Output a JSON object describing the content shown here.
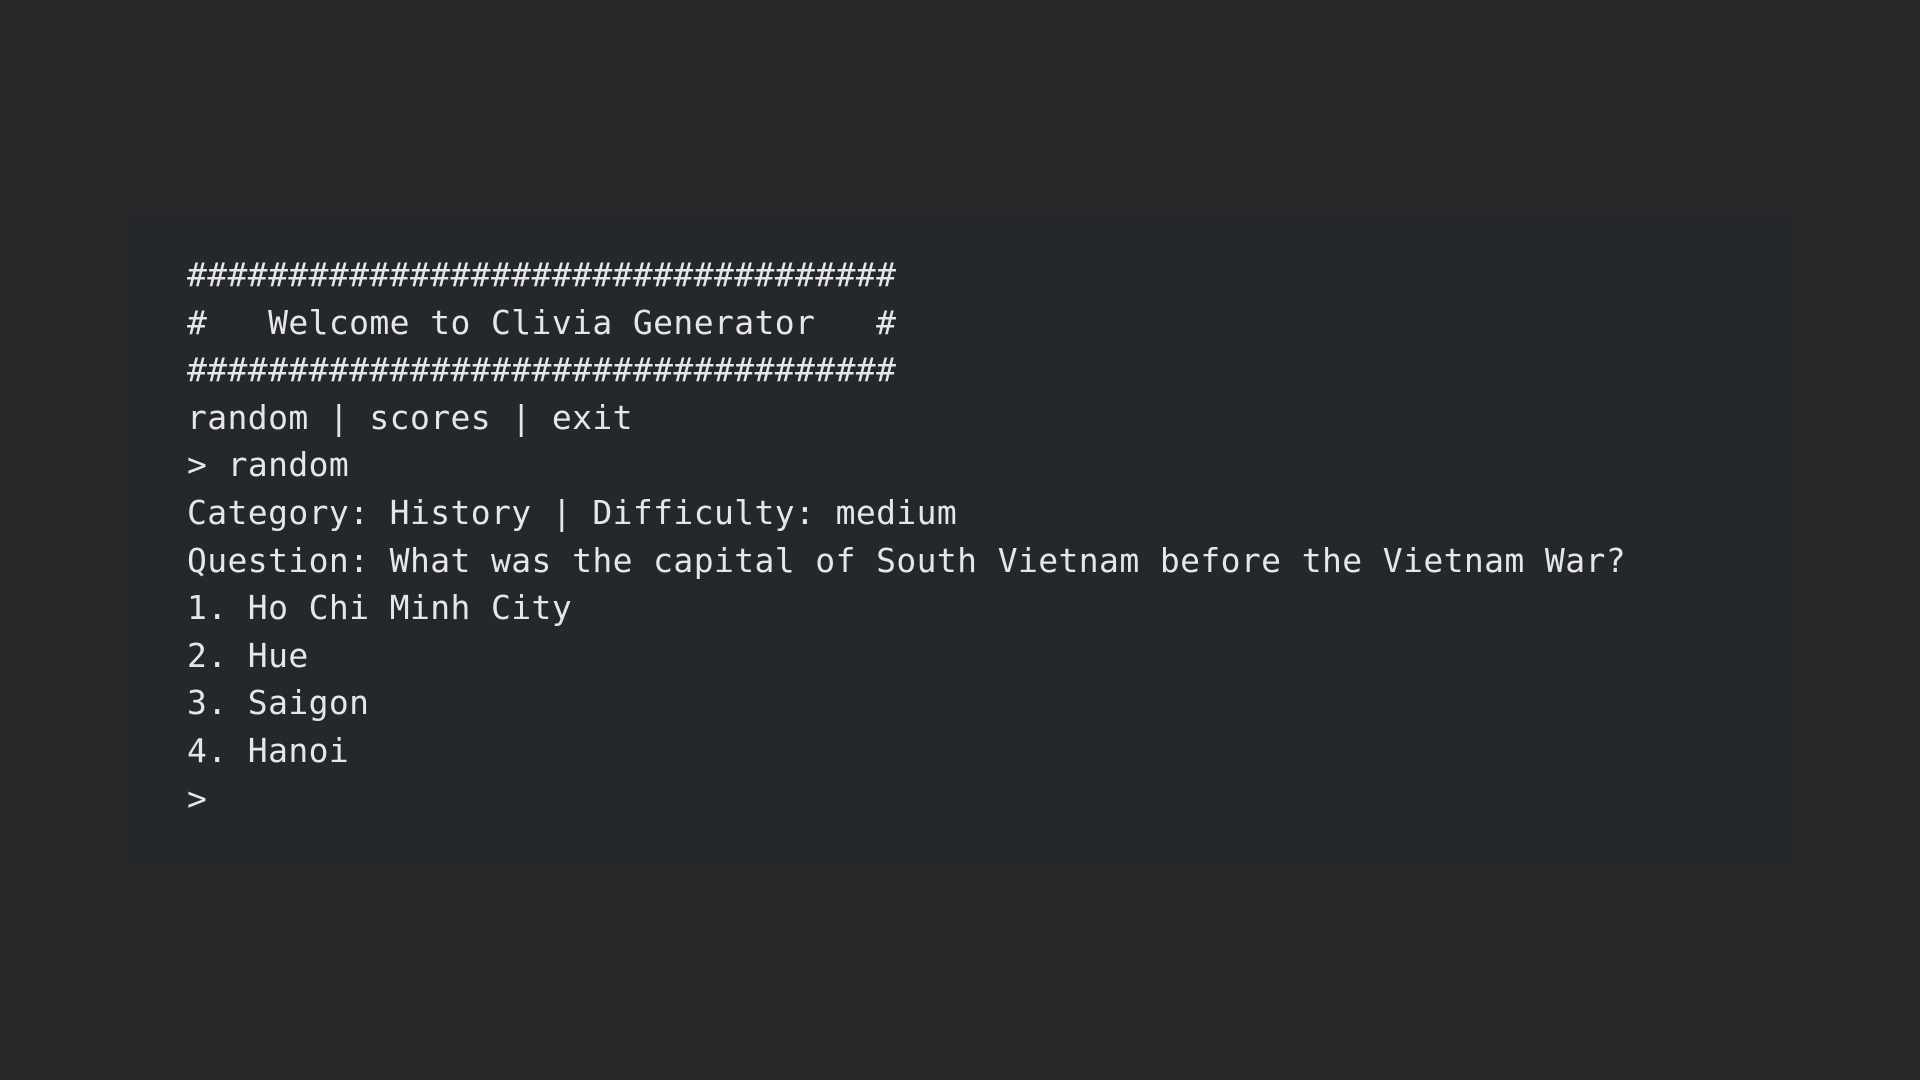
{
  "terminal": {
    "banner_top": "###################################",
    "banner_title": "#   Welcome to Clivia Generator   #",
    "banner_bottom": "###################################",
    "menu": "random | scores | exit",
    "command_prompt": ">",
    "command": "random",
    "meta": "Category: History | Difficulty: medium",
    "question": "Question: What was the capital of South Vietnam before the Vietnam War?",
    "options": [
      "1. Ho Chi Minh City",
      "2. Hue",
      "3. Saigon",
      "4. Hanoi"
    ],
    "input_prompt": ">"
  }
}
